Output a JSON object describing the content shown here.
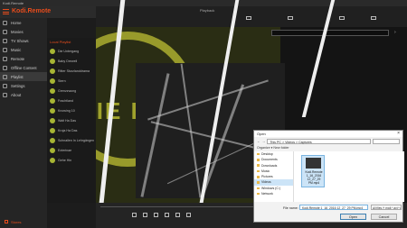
{
  "app": {
    "titlebar": "Kodi.Remote",
    "brand": "Kodi.Remote"
  },
  "sidebar": {
    "items": [
      {
        "label": "Home"
      },
      {
        "label": "Movies"
      },
      {
        "label": "TV Shows"
      },
      {
        "label": "Music"
      },
      {
        "label": "Remote"
      },
      {
        "label": "Offline Content"
      },
      {
        "label": "Playlist"
      },
      {
        "label": "Settings"
      },
      {
        "label": "About"
      }
    ],
    "footer": "Stores"
  },
  "playlist": {
    "title": "Local Playlist",
    "items": [
      "Die Untergang",
      "Baby Drewell",
      "Ritter Sturzlanddrama",
      "Stern",
      "Grenzzwung",
      "Frachtland",
      "Knowing 10",
      "Walt Ha Das",
      "Kroja Ha Das",
      "Schnallen In Lehrgängen",
      "Exterinae",
      "Gehe Hin"
    ]
  },
  "topbar": {
    "label": "Playback"
  },
  "dialog": {
    "title": "Open",
    "address": "This PC  >  Videos  >  Captures",
    "toolbar": "Organize ▾     New folder",
    "tree": [
      "Desktop",
      "Documents",
      "Downloads",
      "Music",
      "Pictures",
      "Videos",
      "Windows (C:)",
      "Network"
    ],
    "selected_tree_index": 5,
    "file": {
      "name": "Kodi.Remote 1_16_2016 12_27_29 PM.mp4"
    },
    "filename_label": "File name:",
    "filename_value": "Kodi.Remote 1_16_2016 12_27_29 PM.mp4",
    "filter": "All files (*.mp4;*.avi;*.mkv)",
    "open_label": "Open",
    "cancel_label": "Cancel"
  },
  "colors": {
    "accent": "#e74c1c",
    "logo": "#c8c934"
  }
}
